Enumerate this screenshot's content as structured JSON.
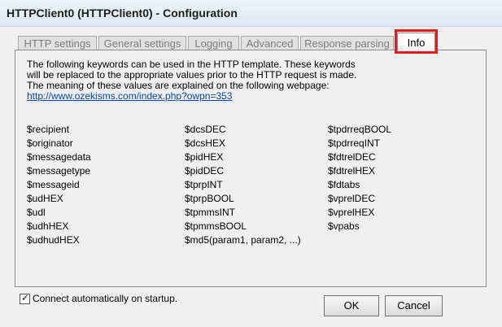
{
  "window": {
    "title": "HTTPClient0 (HTTPClient0) - Configuration"
  },
  "tabs": [
    {
      "label": "HTTP settings",
      "active": false
    },
    {
      "label": "General settings",
      "active": false
    },
    {
      "label": "Logging",
      "active": false
    },
    {
      "label": "Advanced",
      "active": false
    },
    {
      "label": "Response parsing",
      "active": false
    },
    {
      "label": "Info",
      "active": true
    }
  ],
  "info": {
    "lines": [
      "The following keywords can be used in the HTTP template. These keywords",
      "will be replaced to the appropriate values prior to the HTTP request is made.",
      "The meaning of these values are explained on the following webpage:"
    ],
    "link": "http://www.ozekisms.com/index.php?owpn=353",
    "keywords": {
      "col1": [
        "$recipient",
        "$originator",
        "$messagedata",
        "$messagetype",
        "$messageid",
        "$udHEX",
        "$udl",
        "$udhHEX",
        "$udhudHEX"
      ],
      "col2": [
        "$dcsDEC",
        "$dcsHEX",
        "$pidHEX",
        "$pidDEC",
        "$tprpINT",
        "$tprpBOOL",
        "$tpmmsINT",
        "$tpmmsBOOL",
        "$md5(param1, param2, ...)"
      ],
      "col3": [
        "$tpdrreqBOOL",
        "$tpdrreqINT",
        "$fdtrelDEC",
        "$fdtrelHEX",
        "$fdtabs",
        "$vprelDEC",
        "$vprelHEX",
        "$vpabs"
      ]
    }
  },
  "options": {
    "auto_connect_label": "Connect automatically on startup.",
    "auto_connect_checked": true
  },
  "buttons": {
    "ok": "OK",
    "cancel": "Cancel"
  },
  "colors": {
    "highlight": "#e21b1b",
    "link": "#0645ad"
  }
}
